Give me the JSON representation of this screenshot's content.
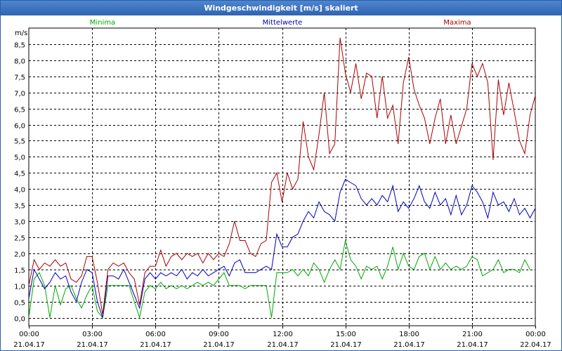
{
  "chart_data": {
    "type": "line",
    "title": "Windgeschwindigkeit [m/s] skaliert",
    "ylabel": "m/s",
    "ylim": [
      -0.25,
      9.0
    ],
    "yticks": [
      "0,0",
      "0,5",
      "1,0",
      "1,5",
      "2,0",
      "2,5",
      "3,0",
      "3,5",
      "4,0",
      "4,5",
      "5,0",
      "5,5",
      "6,0",
      "6,5",
      "7,0",
      "7,5",
      "8,0",
      "8,5"
    ],
    "ytick_values": [
      0,
      0.5,
      1,
      1.5,
      2,
      2.5,
      3,
      3.5,
      4,
      4.5,
      5,
      5.5,
      6,
      6.5,
      7,
      7.5,
      8,
      8.5
    ],
    "xlim": [
      0,
      24
    ],
    "xticks": [
      {
        "t": 0,
        "time": "00:00",
        "date": "21.04.17"
      },
      {
        "t": 3,
        "time": "03:00",
        "date": "21.04.17"
      },
      {
        "t": 6,
        "time": "06:00",
        "date": "21.04.17"
      },
      {
        "t": 9,
        "time": "09:00",
        "date": "21.04.17"
      },
      {
        "t": 12,
        "time": "12:00",
        "date": "21.04.17"
      },
      {
        "t": 15,
        "time": "15:00",
        "date": "21.04.17"
      },
      {
        "t": 18,
        "time": "18:00",
        "date": "21.04.17"
      },
      {
        "t": 21,
        "time": "21:00",
        "date": "21.04.17"
      },
      {
        "t": 24,
        "time": "00:00",
        "date": "22.04.17"
      }
    ],
    "grid": true,
    "series": [
      {
        "name": "Minima",
        "color": "#00aa00",
        "points": [
          [
            0,
            0
          ],
          [
            0.25,
            1.2
          ],
          [
            0.5,
            1.4
          ],
          [
            0.75,
            1
          ],
          [
            1,
            0
          ],
          [
            1.25,
            1
          ],
          [
            1.5,
            0.4
          ],
          [
            1.75,
            0.9
          ],
          [
            2,
            1
          ],
          [
            2.25,
            0.6
          ],
          [
            2.5,
            0.3
          ],
          [
            2.75,
            0.7
          ],
          [
            3,
            1
          ],
          [
            3.25,
            0.2
          ],
          [
            3.5,
            0
          ],
          [
            3.75,
            1
          ],
          [
            4,
            1
          ],
          [
            4.25,
            1
          ],
          [
            4.5,
            1
          ],
          [
            4.75,
            1
          ],
          [
            5,
            0.5
          ],
          [
            5.25,
            0
          ],
          [
            5.5,
            0.8
          ],
          [
            5.75,
            1
          ],
          [
            6,
            0.9
          ],
          [
            6.25,
            1.1
          ],
          [
            6.5,
            0.9
          ],
          [
            6.75,
            1
          ],
          [
            7,
            0.9
          ],
          [
            7.25,
            1
          ],
          [
            7.5,
            0.9
          ],
          [
            7.75,
            1
          ],
          [
            8,
            1.1
          ],
          [
            8.25,
            1
          ],
          [
            8.5,
            1.1
          ],
          [
            8.75,
            1
          ],
          [
            9,
            1.2
          ],
          [
            9.25,
            1.4
          ],
          [
            9.5,
            1
          ],
          [
            9.75,
            1
          ],
          [
            10,
            1
          ],
          [
            10.25,
            0.9
          ],
          [
            10.5,
            1
          ],
          [
            10.75,
            1
          ],
          [
            11,
            1
          ],
          [
            11.25,
            1
          ],
          [
            11.5,
            0
          ],
          [
            11.75,
            1.4
          ],
          [
            12,
            1.4
          ],
          [
            12.25,
            1.4
          ],
          [
            12.5,
            1.5
          ],
          [
            12.75,
            1.3
          ],
          [
            13,
            1.5
          ],
          [
            13.25,
            1.3
          ],
          [
            13.5,
            1.7
          ],
          [
            13.75,
            1.5
          ],
          [
            14,
            1.1
          ],
          [
            14.25,
            1.5
          ],
          [
            14.5,
            1.8
          ],
          [
            14.75,
            1.5
          ],
          [
            15,
            2.4
          ],
          [
            15.25,
            1.8
          ],
          [
            15.5,
            1.6
          ],
          [
            15.75,
            1.2
          ],
          [
            16,
            1.6
          ],
          [
            16.25,
            1.5
          ],
          [
            16.5,
            1.6
          ],
          [
            16.75,
            1.2
          ],
          [
            17,
            1.6
          ],
          [
            17.25,
            2.2
          ],
          [
            17.5,
            1.5
          ],
          [
            17.75,
            2
          ],
          [
            18,
            1.6
          ],
          [
            18.25,
            1.5
          ],
          [
            18.5,
            1.9
          ],
          [
            18.75,
            2
          ],
          [
            19,
            1.5
          ],
          [
            19.25,
            1.9
          ],
          [
            19.5,
            1.5
          ],
          [
            19.75,
            1.7
          ],
          [
            20,
            1.5
          ],
          [
            20.25,
            1.6
          ],
          [
            20.5,
            1.5
          ],
          [
            20.75,
            1.6
          ],
          [
            21,
            1.9
          ],
          [
            21.25,
            1.8
          ],
          [
            21.5,
            1.3
          ],
          [
            21.75,
            1.4
          ],
          [
            22,
            1.5
          ],
          [
            22.25,
            1.8
          ],
          [
            22.5,
            1.4
          ],
          [
            22.75,
            1.5
          ],
          [
            23,
            1.5
          ],
          [
            23.25,
            1.4
          ],
          [
            23.5,
            1.8
          ],
          [
            23.75,
            1.5
          ]
        ]
      },
      {
        "name": "Mittelwerte",
        "color": "#0000bb",
        "points": [
          [
            0,
            0.6
          ],
          [
            0.25,
            1.5
          ],
          [
            0.5,
            1.2
          ],
          [
            0.75,
            0.9
          ],
          [
            1,
            1.1
          ],
          [
            1.25,
            1.4
          ],
          [
            1.5,
            1.2
          ],
          [
            1.75,
            1.3
          ],
          [
            2,
            0.8
          ],
          [
            2.25,
            0.5
          ],
          [
            2.5,
            1.1
          ],
          [
            2.75,
            1.5
          ],
          [
            3,
            1.4
          ],
          [
            3.25,
            0.5
          ],
          [
            3.5,
            0
          ],
          [
            3.75,
            1.3
          ],
          [
            4,
            1.3
          ],
          [
            4.25,
            1.2
          ],
          [
            4.5,
            1.5
          ],
          [
            4.75,
            1.1
          ],
          [
            5,
            0.7
          ],
          [
            5.25,
            0.3
          ],
          [
            5.5,
            1.2
          ],
          [
            5.75,
            1.4
          ],
          [
            6,
            1.2
          ],
          [
            6.25,
            1.4
          ],
          [
            6.5,
            1.3
          ],
          [
            6.75,
            1.4
          ],
          [
            7,
            1.3
          ],
          [
            7.25,
            1.5
          ],
          [
            7.5,
            1.2
          ],
          [
            7.75,
            1.4
          ],
          [
            8,
            1.3
          ],
          [
            8.25,
            1.5
          ],
          [
            8.5,
            1.3
          ],
          [
            8.75,
            1.4
          ],
          [
            9,
            1.5
          ],
          [
            9.25,
            1.6
          ],
          [
            9.5,
            1.3
          ],
          [
            9.75,
            1.7
          ],
          [
            10,
            1.8
          ],
          [
            10.25,
            1.4
          ],
          [
            10.5,
            1.4
          ],
          [
            10.75,
            1.4
          ],
          [
            11,
            1.5
          ],
          [
            11.25,
            1.6
          ],
          [
            11.5,
            1.5
          ],
          [
            11.75,
            2.6
          ],
          [
            12,
            2.2
          ],
          [
            12.25,
            2.2
          ],
          [
            12.5,
            2.5
          ],
          [
            12.75,
            2.6
          ],
          [
            13,
            3
          ],
          [
            13.25,
            3.3
          ],
          [
            13.5,
            3.1
          ],
          [
            13.75,
            3.6
          ],
          [
            14,
            3.3
          ],
          [
            14.25,
            3.2
          ],
          [
            14.5,
            3
          ],
          [
            14.75,
            3.9
          ],
          [
            15,
            4.3
          ],
          [
            15.25,
            4.2
          ],
          [
            15.5,
            4.1
          ],
          [
            15.75,
            3.7
          ],
          [
            16,
            3.5
          ],
          [
            16.25,
            3.7
          ],
          [
            16.5,
            3.5
          ],
          [
            16.75,
            3.8
          ],
          [
            17,
            3.6
          ],
          [
            17.25,
            4.1
          ],
          [
            17.5,
            3.3
          ],
          [
            17.75,
            3.6
          ],
          [
            18,
            3.4
          ],
          [
            18.25,
            3.7
          ],
          [
            18.5,
            4.1
          ],
          [
            18.75,
            3.6
          ],
          [
            19,
            3.4
          ],
          [
            19.25,
            3.9
          ],
          [
            19.5,
            3.5
          ],
          [
            19.75,
            3.7
          ],
          [
            20,
            3.2
          ],
          [
            20.25,
            3.8
          ],
          [
            20.5,
            3.2
          ],
          [
            20.75,
            3.5
          ],
          [
            21,
            4.1
          ],
          [
            21.25,
            3.9
          ],
          [
            21.5,
            3.6
          ],
          [
            21.75,
            3.1
          ],
          [
            22,
            3.9
          ],
          [
            22.25,
            3.5
          ],
          [
            22.5,
            3.6
          ],
          [
            22.75,
            3.3
          ],
          [
            23,
            3.7
          ],
          [
            23.25,
            3.2
          ],
          [
            23.5,
            3.4
          ],
          [
            23.75,
            3.1
          ],
          [
            24,
            3.4
          ]
        ]
      },
      {
        "name": "Maxima",
        "color": "#aa0000",
        "points": [
          [
            0,
            1
          ],
          [
            0.25,
            1.8
          ],
          [
            0.5,
            1.5
          ],
          [
            0.75,
            1.7
          ],
          [
            1,
            1.6
          ],
          [
            1.25,
            1.8
          ],
          [
            1.5,
            1.6
          ],
          [
            1.75,
            1.7
          ],
          [
            2,
            1.2
          ],
          [
            2.25,
            1.1
          ],
          [
            2.5,
            1.3
          ],
          [
            2.75,
            1.9
          ],
          [
            3,
            1.9
          ],
          [
            3.25,
            1.1
          ],
          [
            3.5,
            0.1
          ],
          [
            3.75,
            1.5
          ],
          [
            4,
            1.7
          ],
          [
            4.25,
            1.6
          ],
          [
            4.5,
            1.7
          ],
          [
            4.75,
            1.4
          ],
          [
            5,
            1.2
          ],
          [
            5.25,
            0.4
          ],
          [
            5.5,
            1.4
          ],
          [
            5.75,
            1.6
          ],
          [
            6,
            1.6
          ],
          [
            6.25,
            2.1
          ],
          [
            6.5,
            1.6
          ],
          [
            6.75,
            1.9
          ],
          [
            7,
            2
          ],
          [
            7.25,
            1.8
          ],
          [
            7.5,
            2
          ],
          [
            7.75,
            1.9
          ],
          [
            8,
            2
          ],
          [
            8.25,
            1.7
          ],
          [
            8.5,
            2
          ],
          [
            8.75,
            1.8
          ],
          [
            9,
            2
          ],
          [
            9.25,
            1.9
          ],
          [
            9.5,
            2.3
          ],
          [
            9.75,
            3
          ],
          [
            10,
            2.4
          ],
          [
            10.25,
            2.4
          ],
          [
            10.5,
            2
          ],
          [
            10.75,
            1.9
          ],
          [
            11,
            2.3
          ],
          [
            11.25,
            2.4
          ],
          [
            11.5,
            4.2
          ],
          [
            11.75,
            4.5
          ],
          [
            12,
            3.6
          ],
          [
            12.25,
            4.5
          ],
          [
            12.5,
            4
          ],
          [
            12.75,
            4.3
          ],
          [
            13,
            6.1
          ],
          [
            13.25,
            5
          ],
          [
            13.5,
            4.6
          ],
          [
            13.75,
            5.7
          ],
          [
            14,
            7
          ],
          [
            14.25,
            5.1
          ],
          [
            14.5,
            5.4
          ],
          [
            14.75,
            8.7
          ],
          [
            15,
            7.6
          ],
          [
            15.25,
            7
          ],
          [
            15.5,
            7.9
          ],
          [
            15.75,
            6.8
          ],
          [
            16,
            7.6
          ],
          [
            16.25,
            7.5
          ],
          [
            16.5,
            6.2
          ],
          [
            16.75,
            7.5
          ],
          [
            17,
            6.2
          ],
          [
            17.25,
            6.6
          ],
          [
            17.5,
            5.4
          ],
          [
            17.75,
            7.3
          ],
          [
            18,
            8.1
          ],
          [
            18.25,
            7.1
          ],
          [
            18.5,
            6.6
          ],
          [
            18.75,
            6.2
          ],
          [
            19,
            5.4
          ],
          [
            19.25,
            6.2
          ],
          [
            19.5,
            6.8
          ],
          [
            19.75,
            5.4
          ],
          [
            20,
            6.3
          ],
          [
            20.25,
            5.4
          ],
          [
            20.75,
            6.5
          ],
          [
            21,
            7.9
          ],
          [
            21.25,
            7.5
          ],
          [
            21.5,
            7.9
          ],
          [
            21.75,
            7.3
          ],
          [
            22,
            4.9
          ],
          [
            22.25,
            7.4
          ],
          [
            22.5,
            6.3
          ],
          [
            22.75,
            7.3
          ],
          [
            23,
            6.4
          ],
          [
            23.25,
            5.5
          ],
          [
            23.5,
            5.1
          ],
          [
            23.75,
            6.3
          ],
          [
            24,
            6.9
          ]
        ]
      }
    ]
  }
}
